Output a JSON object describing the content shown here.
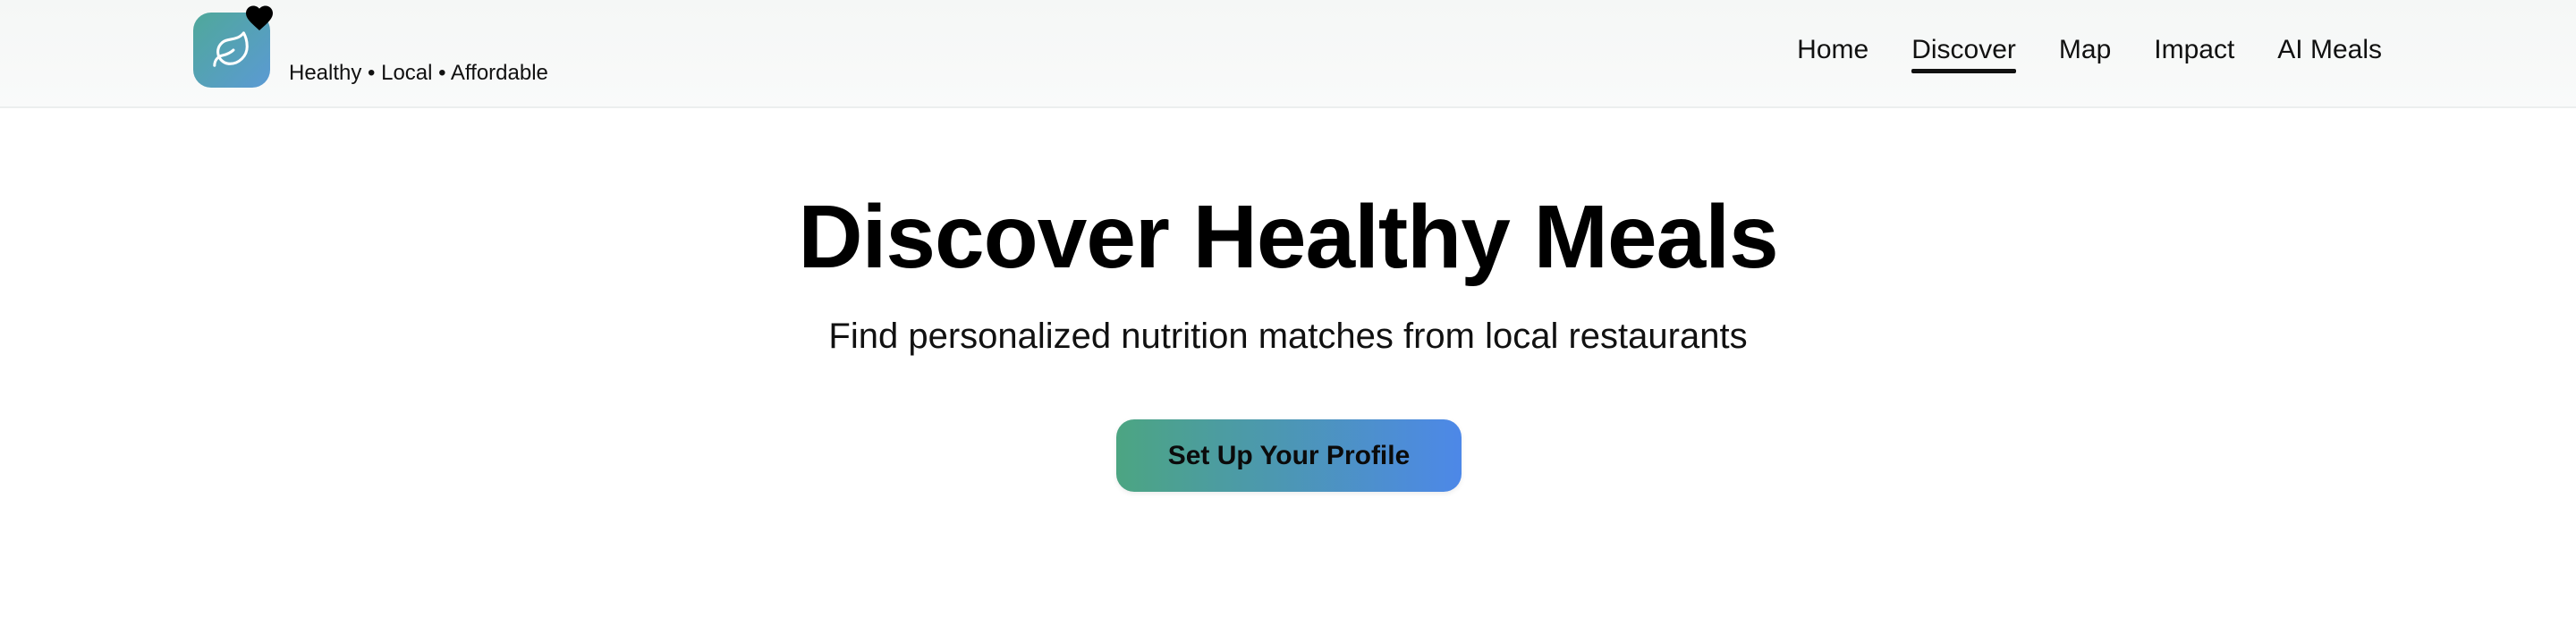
{
  "header": {
    "tagline": "Healthy • Local • Affordable",
    "logo_icon": "leaf-icon",
    "badge_icon": "heart-icon",
    "nav": [
      {
        "label": "Home",
        "active": false
      },
      {
        "label": "Discover",
        "active": true
      },
      {
        "label": "Map",
        "active": false
      },
      {
        "label": "Impact",
        "active": false
      },
      {
        "label": "AI Meals",
        "active": false
      }
    ]
  },
  "hero": {
    "title": "Discover Healthy Meals",
    "subtitle": "Find personalized nutrition matches from local restaurants",
    "cta_label": "Set Up Your Profile"
  },
  "colors": {
    "logo_gradient_start": "#4fa89a",
    "logo_gradient_end": "#5b9ad4",
    "cta_gradient_start": "#4ca582",
    "cta_gradient_end": "#4d88e8"
  }
}
